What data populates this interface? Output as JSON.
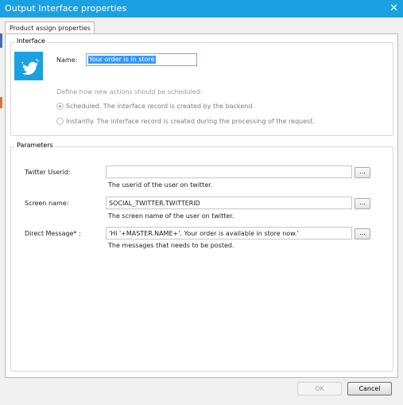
{
  "window": {
    "title": "Output Interface properties",
    "close_glyph": "✕"
  },
  "tab": {
    "label": "Product assign properties"
  },
  "interface_group": {
    "label": "Interface",
    "icon": "twitter-icon",
    "name_label": "Name:",
    "name_value": "Your order is in store",
    "schedule_hint": "Define how new actions should be scheduled:",
    "options": [
      {
        "label": "Scheduled. The interface record is created by the backend",
        "checked": true
      },
      {
        "label": "Instantly. The interface record is created during the processing of the request.",
        "checked": false
      }
    ]
  },
  "parameters_group": {
    "label": "Parameters",
    "fields": [
      {
        "label": "Twitter Userid:",
        "value": "",
        "description": "The userid of the user on twitter."
      },
      {
        "label": "Screen name:",
        "value": "SOCIAL_TWITTER.TWITTERID",
        "description": "The screen name of the user on twitter."
      },
      {
        "label": "Direct Message* :",
        "value": "'Hi '+MASTER.NAME+'. Your order is available in store now.'",
        "description": "The messages that needs to be posted."
      }
    ],
    "browse_label": "..."
  },
  "footer": {
    "ok_label": "OK",
    "cancel_label": "Cancel"
  },
  "colors": {
    "titlebar": "#1ba1e2",
    "accent": "#3399ff"
  }
}
